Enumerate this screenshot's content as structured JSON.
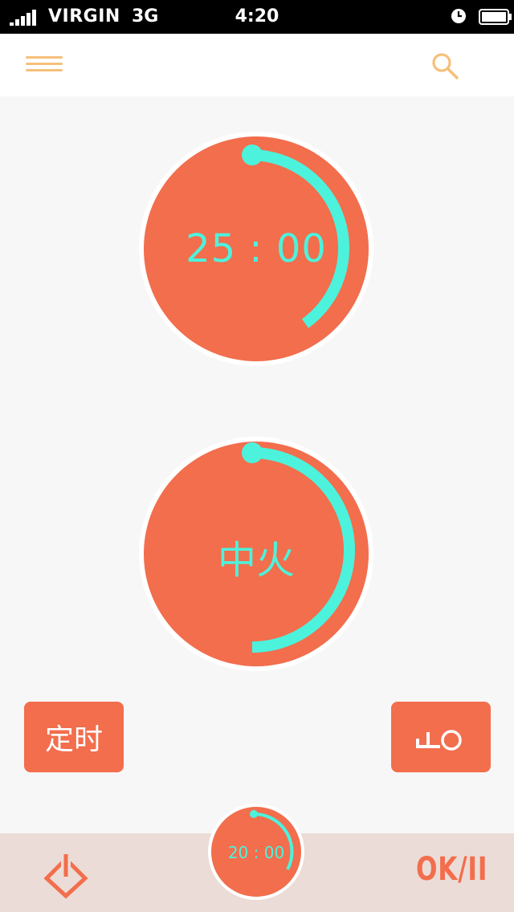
{
  "status_bar": {
    "carrier": "VIRGIN",
    "network": "3G",
    "time": "4:20"
  },
  "header": {
    "menu_icon": "hamburger-menu-icon",
    "search_icon": "search-icon"
  },
  "timer_dial": {
    "value": "25 : 00"
  },
  "heat_dial": {
    "value": "中火"
  },
  "buttons": {
    "timer_label": "定时",
    "key_icon": "key-icon"
  },
  "bottom_bar": {
    "power_icon": "power-icon",
    "mini_timer": "20 : 00",
    "ok_pause_label": "OK/II"
  },
  "colors": {
    "accent": "#f26e4d",
    "arc": "#4df2dc",
    "header_icon": "#f6c07a",
    "background": "#f7f7f7",
    "bottom_bar": "#ebdcd7"
  }
}
